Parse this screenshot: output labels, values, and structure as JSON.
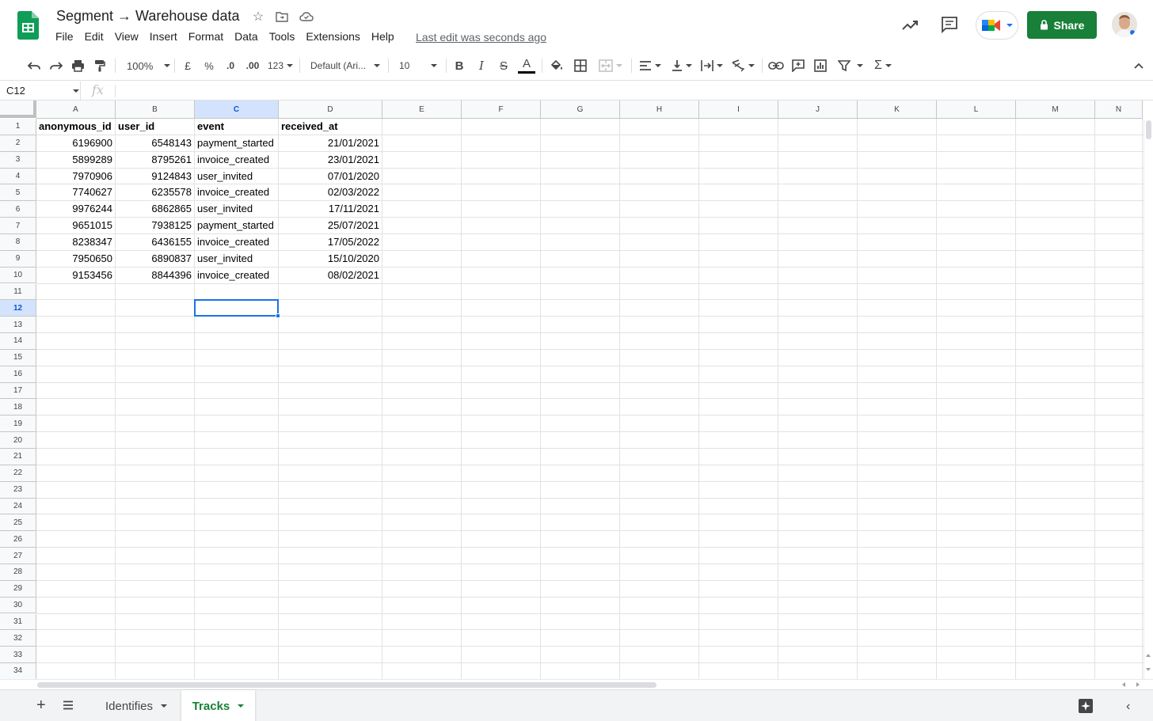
{
  "app": {
    "title": "Segment → Warehouse data",
    "last_edit": "Last edit was seconds ago",
    "share_label": "Share",
    "menu": [
      "File",
      "Edit",
      "View",
      "Insert",
      "Format",
      "Data",
      "Tools",
      "Extensions",
      "Help"
    ]
  },
  "toolbar": {
    "zoom": "100%",
    "currency": "£",
    "percent": "%",
    "decrease_decimal": ".0",
    "increase_decimal": ".00",
    "number_format": "123",
    "font": "Default (Ari...",
    "font_size": "10",
    "bold": "B",
    "italic": "I",
    "strike": "S",
    "text_color": "A",
    "sum": "Σ"
  },
  "formula_bar": {
    "cell_ref": "C12",
    "fx": "fx",
    "value": ""
  },
  "columns": [
    "A",
    "B",
    "C",
    "D",
    "E",
    "F",
    "G",
    "H",
    "I",
    "J",
    "K",
    "L",
    "M",
    "N"
  ],
  "rows": [
    "1",
    "2",
    "3",
    "4",
    "5",
    "6",
    "7",
    "8",
    "9",
    "10",
    "11",
    "12",
    "13",
    "14",
    "15",
    "16",
    "17",
    "18",
    "19",
    "20",
    "21",
    "22",
    "23",
    "24",
    "25",
    "26",
    "27",
    "28",
    "29",
    "30",
    "31",
    "32",
    "33",
    "34"
  ],
  "table": {
    "headers": [
      "anonymous_id",
      "user_id",
      "event",
      "received_at"
    ],
    "rows": [
      [
        "6196900",
        "6548143",
        "payment_started",
        "21/01/2021"
      ],
      [
        "5899289",
        "8795261",
        "invoice_created",
        "23/01/2021"
      ],
      [
        "7970906",
        "9124843",
        "user_invited",
        "07/01/2020"
      ],
      [
        "7740627",
        "6235578",
        "invoice_created",
        "02/03/2022"
      ],
      [
        "9976244",
        "6862865",
        "user_invited",
        "17/11/2021"
      ],
      [
        "9651015",
        "7938125",
        "payment_started",
        "25/07/2021"
      ],
      [
        "8238347",
        "6436155",
        "invoice_created",
        "17/05/2022"
      ],
      [
        "7950650",
        "6890837",
        "user_invited",
        "15/10/2020"
      ],
      [
        "9153456",
        "8844396",
        "invoice_created",
        "08/02/2021"
      ]
    ]
  },
  "selection": {
    "column": "C",
    "row": "12"
  },
  "sheets": [
    {
      "name": "Identifies",
      "active": false
    },
    {
      "name": "Tracks",
      "active": true
    }
  ],
  "colors": {
    "share_green": "#188038",
    "selection_blue": "#1a73e8",
    "active_tab_text": "#188038"
  }
}
